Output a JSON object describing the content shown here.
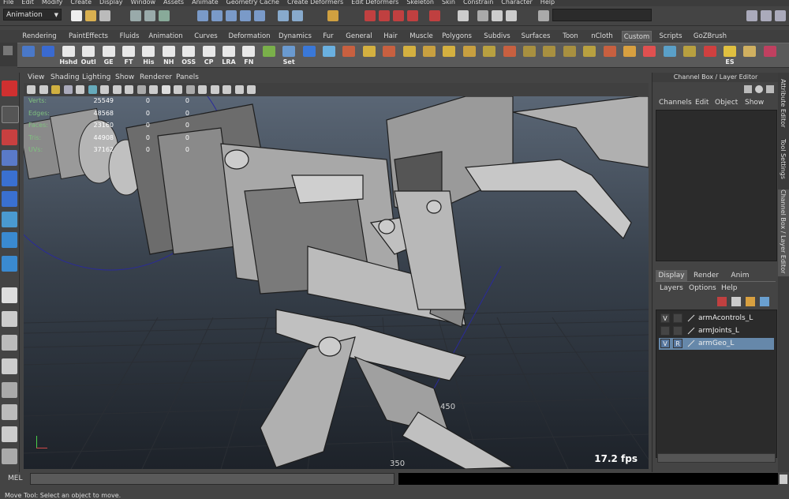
{
  "menubar": [
    "File",
    "Edit",
    "Modify",
    "Create",
    "Display",
    "Window",
    "Assets",
    "Animate",
    "Geometry Cache",
    "Create Deformers",
    "Edit Deformers",
    "Skeleton",
    "Skin",
    "Constrain",
    "Character",
    "Help"
  ],
  "statusline": {
    "mode": "Animation"
  },
  "shelf": {
    "tabs": [
      "Rendering",
      "PaintEffects",
      "Fluids",
      "Animation",
      "Curves",
      "Deformation",
      "Dynamics",
      "Fur",
      "General",
      "Hair",
      "Muscle",
      "Polygons",
      "Subdivs",
      "Surfaces",
      "Toon",
      "nCloth",
      "Custom",
      "Scripts",
      "GoZBrush"
    ],
    "active_tab": "Custom",
    "buttons": [
      {
        "label": "",
        "color": "#4a78c8"
      },
      {
        "label": "",
        "color": "#3a6ad0"
      },
      {
        "label": "Hshd",
        "color": "#e8e8e8"
      },
      {
        "label": "Outl",
        "color": "#e8e8e8"
      },
      {
        "label": "GE",
        "color": "#e8e8e8"
      },
      {
        "label": "FT",
        "color": "#e8e8e8"
      },
      {
        "label": "His",
        "color": "#e8e8e8"
      },
      {
        "label": "NH",
        "color": "#e8e8e8"
      },
      {
        "label": "OSS",
        "color": "#e8e8e8"
      },
      {
        "label": "CP",
        "color": "#e8e8e8"
      },
      {
        "label": "LRA",
        "color": "#e8e8e8"
      },
      {
        "label": "FN",
        "color": "#e8e8e8"
      },
      {
        "label": "",
        "color": "#7ab04a"
      },
      {
        "label": "Set",
        "color": "#6a9ad0"
      },
      {
        "label": "",
        "color": "#3a78d8"
      },
      {
        "label": "",
        "color": "#6ab0e0"
      },
      {
        "label": "",
        "color": "#c86040"
      },
      {
        "label": "",
        "color": "#d4b040"
      },
      {
        "label": "",
        "color": "#c86040"
      },
      {
        "label": "",
        "color": "#d4b040"
      },
      {
        "label": "",
        "color": "#c8a040"
      },
      {
        "label": "",
        "color": "#d4b040"
      },
      {
        "label": "",
        "color": "#c8a040"
      },
      {
        "label": "",
        "color": "#b8a040"
      },
      {
        "label": "",
        "color": "#c86040"
      },
      {
        "label": "",
        "color": "#a89040"
      },
      {
        "label": "",
        "color": "#a89040"
      },
      {
        "label": "",
        "color": "#a89040"
      },
      {
        "label": "",
        "color": "#b8a040"
      },
      {
        "label": "",
        "color": "#c86040"
      },
      {
        "label": "",
        "color": "#d8a040"
      },
      {
        "label": "",
        "color": "#e05050"
      },
      {
        "label": "",
        "color": "#5aa0c8"
      },
      {
        "label": "",
        "color": "#b8a040"
      },
      {
        "label": "",
        "color": "#d04040"
      },
      {
        "label": "ES",
        "color": "#e0c040"
      },
      {
        "label": "",
        "color": "#d0b060"
      },
      {
        "label": "",
        "color": "#c04060"
      }
    ]
  },
  "viewport": {
    "menu": [
      "View",
      "Shading",
      "Lighting",
      "Show",
      "Renderer",
      "Panels"
    ],
    "hud": [
      {
        "label": "Verts:",
        "value": "25549",
        "sel": "0",
        "sel2": "0"
      },
      {
        "label": "Edges:",
        "value": "48568",
        "sel": "0",
        "sel2": "0"
      },
      {
        "label": "Faces:",
        "value": "23160",
        "sel": "0",
        "sel2": "0"
      },
      {
        "label": "Tris:",
        "value": "44908",
        "sel": "0",
        "sel2": "0"
      },
      {
        "label": "UVs:",
        "value": "37162",
        "sel": "0",
        "sel2": "0"
      }
    ],
    "fps": "17.2 fps",
    "grid_labels": [
      "450",
      "350"
    ]
  },
  "channelbox": {
    "title": "Channel Box / Layer Editor",
    "menu": [
      "Channels",
      "Edit",
      "Object",
      "Show"
    ]
  },
  "layer_editor": {
    "tabs": [
      "Display",
      "Render",
      "Anim"
    ],
    "active_tab": "Display",
    "menu": [
      "Layers",
      "Options",
      "Help"
    ],
    "layers": [
      {
        "v": "V",
        "r": "",
        "name": "armAcontrols_L",
        "selected": false
      },
      {
        "v": "",
        "r": "",
        "name": "armJoints_L",
        "selected": false
      },
      {
        "v": "V",
        "r": "R",
        "name": "armGeo_L",
        "selected": true
      }
    ]
  },
  "side_tabs": [
    "Attribute Editor",
    "Tool Settings",
    "Channel Box / Layer Editor"
  ],
  "bottom": {
    "mel_label": "MEL",
    "help": "Move Tool: Select an object to move."
  }
}
